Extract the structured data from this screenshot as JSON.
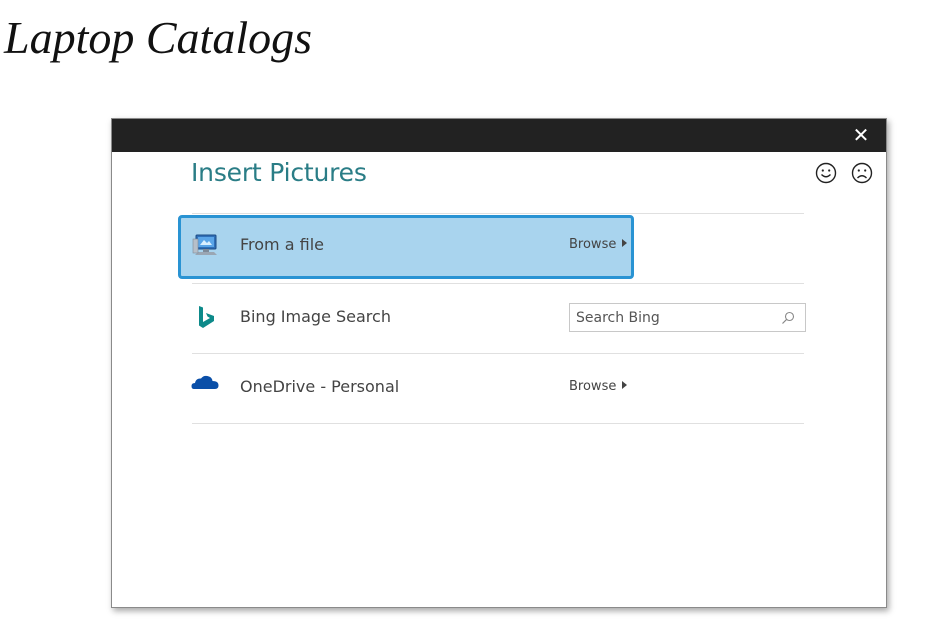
{
  "heading": "Laptop Catalogs",
  "dialog": {
    "title": "Insert Pictures",
    "close_glyph": "✕",
    "feedback": {
      "smile_icon": "smiley-face-icon",
      "frown_icon": "frowning-face-icon"
    },
    "sources": [
      {
        "label": "From a file",
        "icon": "computer-icon",
        "action": "Browse",
        "selected": true
      },
      {
        "label": "Bing Image Search",
        "icon": "bing-icon",
        "search_placeholder": "Search Bing",
        "selected": false
      },
      {
        "label": "OneDrive - Personal",
        "icon": "onedrive-cloud-icon",
        "action": "Browse",
        "selected": false
      }
    ]
  },
  "colors": {
    "accent": "#2a7d86",
    "selection_fill": "#a9d4ee",
    "selection_border": "#2993d3",
    "bing": "#0d8a8a",
    "onedrive": "#0a4fa8",
    "titlebar": "#222222"
  }
}
